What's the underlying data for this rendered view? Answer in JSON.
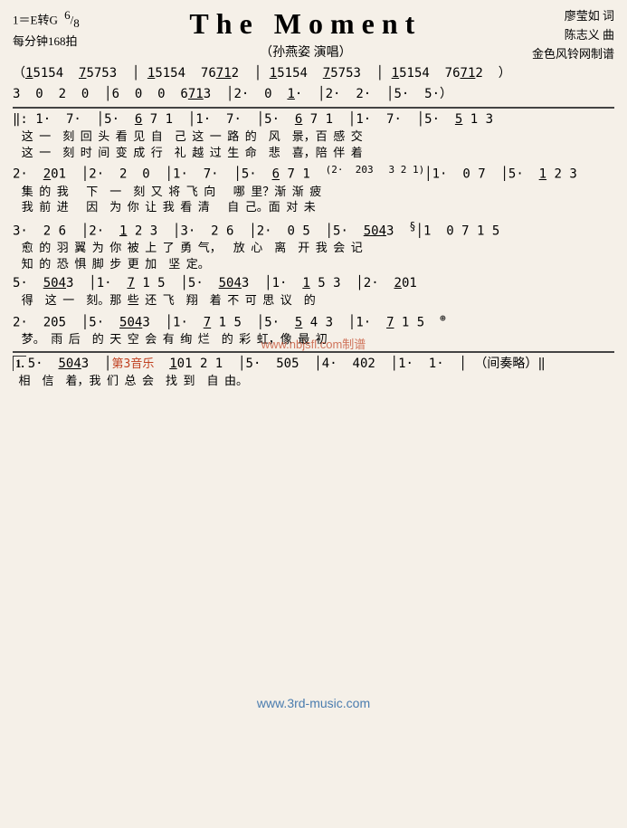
{
  "header": {
    "key": "1＝E转G",
    "time": "6/8",
    "tempo": "每分钟168拍",
    "title": "The  Moment",
    "performer": "（孙燕姿  演唱）",
    "lyricist": "廖莹如  词",
    "composer": "陈志义  曲",
    "arranger": "金色风铃网制谱"
  },
  "watermark1": "www.nbjsfl.com制谱",
  "watermark2": "www.3rd-music.com",
  "intro": "（1̇5154  7̇5753  │ 1̇5154  76712  │ 1̇5154  7̇5753  │ 1̇5154  76712  ）",
  "line1_notes": "3  0  2  0  │6  0  0  6713  │2·  0  1̇  │2·  2·  │5·  5·）",
  "sections": []
}
